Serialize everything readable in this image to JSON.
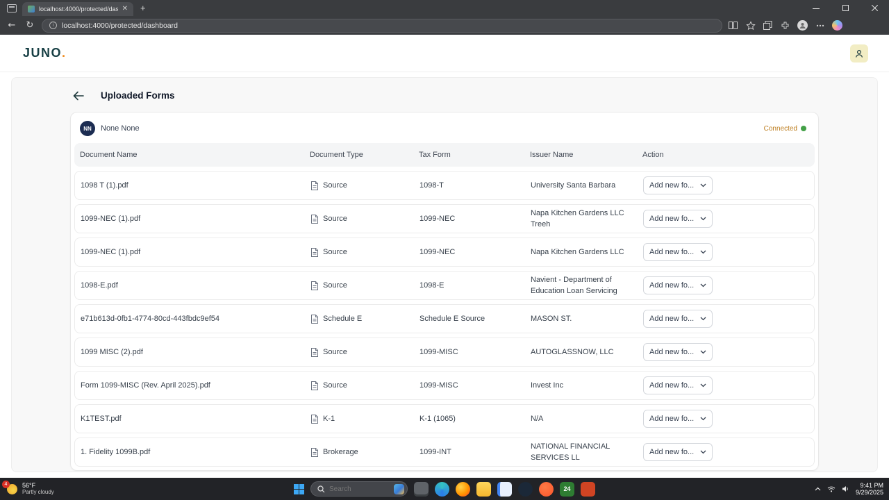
{
  "browser": {
    "tab_title": "localhost:4000/protected/dashb...",
    "url": "localhost:4000/protected/dashboard"
  },
  "header": {
    "brand": "JUNO",
    "brand_dot": "."
  },
  "page": {
    "title": "Uploaded Forms"
  },
  "account": {
    "initials": "NN",
    "name": "None None",
    "status": "Connected"
  },
  "table": {
    "headers": [
      "Document Name",
      "Document Type",
      "Tax Form",
      "Issuer Name",
      "Action"
    ],
    "action_label": "Add new fo...",
    "rows": [
      {
        "document_name": "1098 T (1).pdf",
        "document_type": "Source",
        "tax_form": "1098-T",
        "issuer_name": "University Santa Barbara"
      },
      {
        "document_name": "1099-NEC (1).pdf",
        "document_type": "Source",
        "tax_form": "1099-NEC",
        "issuer_name": "Napa Kitchen Gardens LLC Treeh"
      },
      {
        "document_name": "1099-NEC (1).pdf",
        "document_type": "Source",
        "tax_form": "1099-NEC",
        "issuer_name": "Napa Kitchen Gardens LLC"
      },
      {
        "document_name": "1098-E.pdf",
        "document_type": "Source",
        "tax_form": "1098-E",
        "issuer_name": "Navient - Department of Education Loan Servicing"
      },
      {
        "document_name": "e71b613d-0fb1-4774-80cd-443fbdc9ef54",
        "document_type": "Schedule E",
        "tax_form": "Schedule E Source",
        "issuer_name": "MASON ST."
      },
      {
        "document_name": "1099 MISC (2).pdf",
        "document_type": "Source",
        "tax_form": "1099-MISC",
        "issuer_name": "AUTOGLASSNOW, LLC"
      },
      {
        "document_name": "Form 1099-MISC (Rev. April 2025).pdf",
        "document_type": "Source",
        "tax_form": "1099-MISC",
        "issuer_name": "Invest Inc"
      },
      {
        "document_name": "K1TEST.pdf",
        "document_type": "K-1",
        "tax_form": "K-1 (1065)",
        "issuer_name": "N/A"
      },
      {
        "document_name": "1. Fidelity 1099B.pdf",
        "document_type": "Brokerage",
        "tax_form": "1099-INT",
        "issuer_name": "NATIONAL FINANCIAL SERVICES LL"
      }
    ]
  },
  "taskbar": {
    "weather": {
      "badge": "4",
      "temp": "56°F",
      "condition": "Partly cloudy"
    },
    "search_placeholder": "Search",
    "apps": [
      {
        "id": "media",
        "text": ""
      },
      {
        "id": "edge",
        "text": ""
      },
      {
        "id": "firefox",
        "text": ""
      },
      {
        "id": "file-explorer",
        "text": ""
      },
      {
        "id": "notepad",
        "text": ""
      },
      {
        "id": "steam",
        "text": ""
      },
      {
        "id": "brave",
        "text": ""
      },
      {
        "id": "badge-24",
        "text": "24"
      },
      {
        "id": "powerpoint",
        "text": ""
      }
    ],
    "clock": {
      "time": "9:41 PM",
      "date": "9/29/2025"
    }
  }
}
